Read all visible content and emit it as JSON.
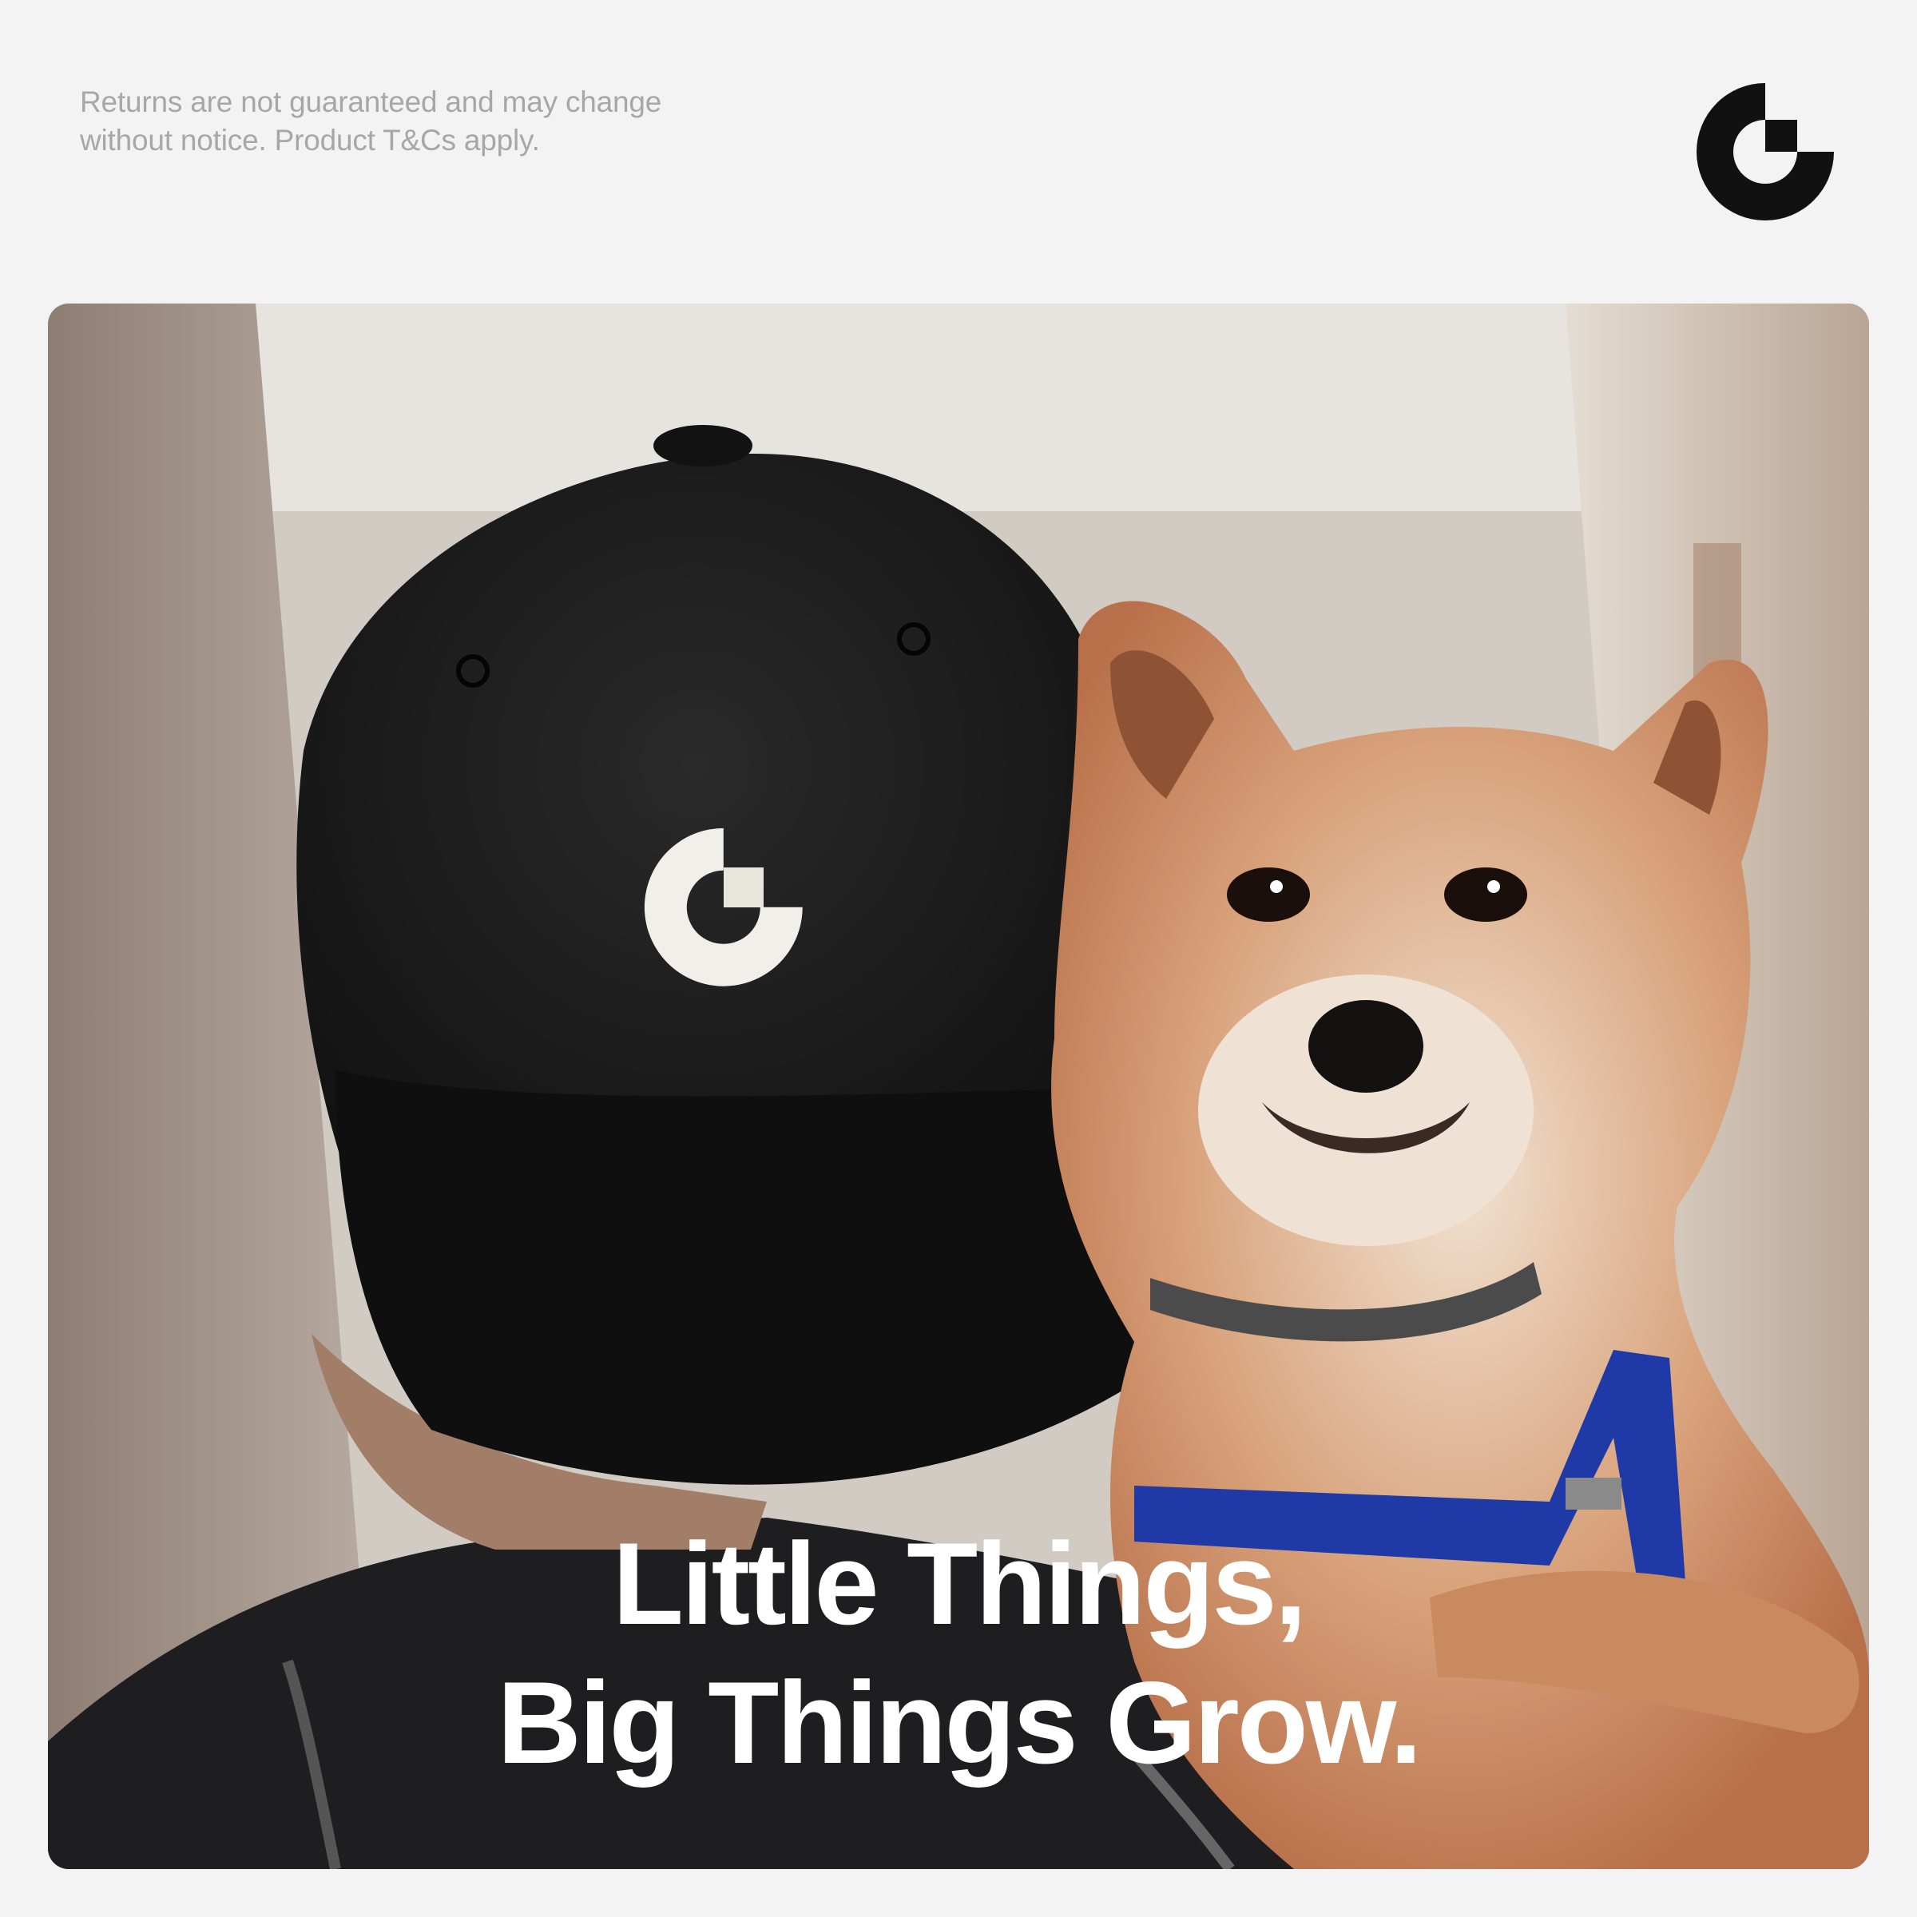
{
  "disclaimer": {
    "line1": "Returns are not guaranteed and may change",
    "line2": "without notice. Product T&Cs apply."
  },
  "brand": {
    "logo_icon": "brand-g-logo-icon",
    "logo_color": "#111111"
  },
  "hero": {
    "image_subject": "person in black cap with embroidered logo holding shiba inu dog",
    "headline_line1": "Little Things,",
    "headline_line2": "Big Things Grow.",
    "headline_color": "#ffffff"
  },
  "colors": {
    "page_background": "#f3f3f3",
    "disclaimer_text": "#a7a7a7",
    "harness_blue": "#1f3aa6"
  }
}
